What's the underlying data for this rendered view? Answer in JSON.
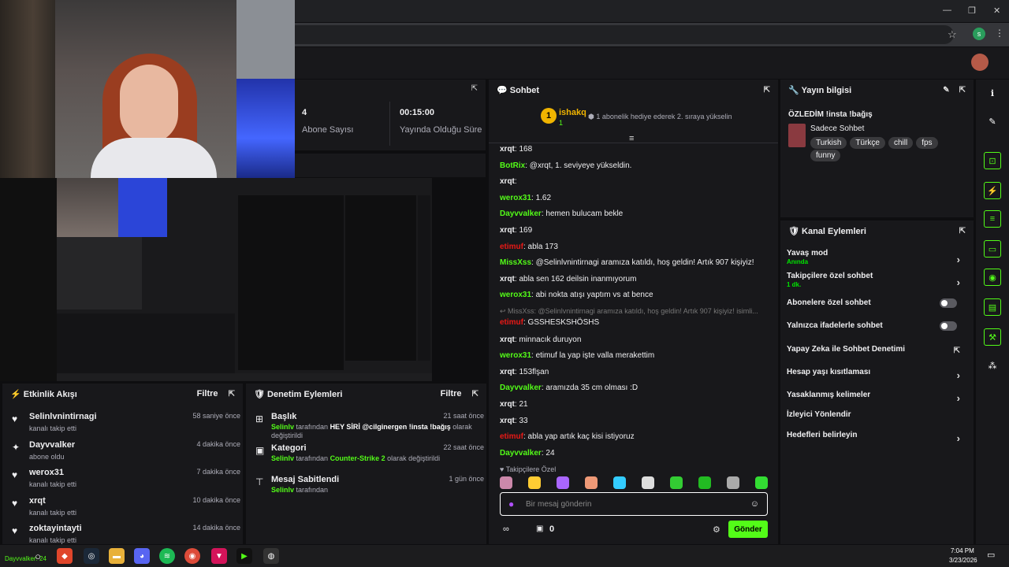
{
  "browser": {
    "window_controls": [
      "—",
      "❐",
      "✕"
    ],
    "profile_initial": "s"
  },
  "stats": [
    {
      "value": "4",
      "label": "Abone Sayısı"
    },
    {
      "value": "00:15:00",
      "label": "Yayında Olduğu Süre"
    }
  ],
  "chat": {
    "title": "Sohbet",
    "top_user": {
      "rank": "1",
      "name": "ishakq",
      "count": "1",
      "note": "1 abonelik hediye ederek 2. sıraya yükselin"
    },
    "messages": [
      {
        "user": "xrqt",
        "text": "168",
        "color": "#efeff1"
      },
      {
        "user": "BotRix",
        "text": "@xrqt, 1. seviyeye yükseldin.",
        "color": "#53fc18"
      },
      {
        "user": "xrqt",
        "text": "",
        "color": "#efeff1"
      },
      {
        "user": "werox31",
        "text": "1.62",
        "color": "#53fc18"
      },
      {
        "user": "Dayvvalker",
        "text": "hemen bulucam bekle",
        "color": "#53fc18"
      },
      {
        "user": "xrqt",
        "text": "169",
        "color": "#efeff1"
      },
      {
        "user": "etimuf",
        "text": "abla 173",
        "color": "#e91916"
      },
      {
        "user": "MissXss",
        "text": "@Selinlvnintirnagi aramıza katıldı, hoş geldin! Artık 907 kişiyiz!",
        "color": "#53fc18"
      },
      {
        "user": "xrqt",
        "text": "abla sen 162 deilsin inanmıyorum",
        "color": "#efeff1"
      },
      {
        "user": "werox31",
        "text": "abi nokta atışı yaptım vs at bence",
        "color": "#53fc18"
      },
      {
        "user": "etimuf",
        "text": "GSSHESKSHÖSHS",
        "color": "#e91916",
        "reply": "MissXss: @Selinlvnintirnagi aramıza katıldı, hoş geldin! Artık 907 kişiyiz!",
        "reply_tail": "isimli..."
      },
      {
        "user": "xrqt",
        "text": "minnacık duruyon",
        "color": "#efeff1"
      },
      {
        "user": "werox31",
        "text": "etimuf la yap işte valla merakettim",
        "color": "#53fc18"
      },
      {
        "user": "xrqt",
        "text": "153flşan",
        "color": "#efeff1"
      },
      {
        "user": "Dayvvalker",
        "text": "aramızda 35 cm olması :D",
        "color": "#53fc18"
      },
      {
        "user": "xrqt",
        "text": "21",
        "color": "#efeff1"
      },
      {
        "user": "xrqt",
        "text": "33",
        "color": "#efeff1"
      },
      {
        "user": "etimuf",
        "text": "abla yap artık kaç kisi istiyoruz",
        "color": "#e91916"
      },
      {
        "user": "Dayvvalker",
        "text": "24",
        "color": "#53fc18"
      }
    ],
    "emote_label": "Takipçilere Özel",
    "placeholder": "Bir mesaj gönderin",
    "points": "0",
    "send_label": "Gönder"
  },
  "stream_info": {
    "title": "Yayın bilgisi",
    "stream_title": "ÖZLEDİM !insta !bağış",
    "category": "Sadece Sohbet",
    "tags": [
      "Turkish",
      "Türkçe",
      "chill",
      "fps",
      "funny"
    ]
  },
  "channel_actions": {
    "title": "Kanal Eylemleri",
    "items": [
      {
        "label": "Yavaş mod",
        "sub": "Anında",
        "control": "chevron"
      },
      {
        "label": "Takipçilere özel sohbet",
        "sub": "1 dk.",
        "control": "chevron"
      },
      {
        "label": "Abonelere özel sohbet",
        "sub": "",
        "control": "toggle"
      },
      {
        "label": "Yalnızca ifadelerle sohbet",
        "sub": "",
        "control": "toggle"
      },
      {
        "label": "Yapay Zeka ile Sohbet Denetimi",
        "sub": "",
        "control": "external"
      },
      {
        "label": "Hesap yaşı kısıtlaması",
        "sub": "",
        "control": "chevron"
      },
      {
        "label": "Yasaklanmış kelimeler",
        "sub": "",
        "control": "chevron"
      },
      {
        "label": "İzleyici Yönlendir",
        "sub": "",
        "control": "none"
      },
      {
        "label": "Hedefleri belirleyin",
        "sub": "",
        "control": "chevron"
      }
    ]
  },
  "activity": {
    "title": "Etkinlik Akışı",
    "filter": "Filtre",
    "events": [
      {
        "name": "Selinlvnintirnagi",
        "action": "kanalı takip etti",
        "time": "58 saniye önce",
        "icon": "heart-icon",
        "glyph": "♥"
      },
      {
        "name": "Dayvvalker",
        "action": "abone oldu",
        "time": "4 dakika önce",
        "icon": "sparkle-icon",
        "glyph": "✦"
      },
      {
        "name": "werox31",
        "action": "kanalı takip etti",
        "time": "7 dakika önce",
        "icon": "heart-icon",
        "glyph": "♥"
      },
      {
        "name": "xrqt",
        "action": "kanalı takip etti",
        "time": "10 dakika önce",
        "icon": "heart-icon",
        "glyph": "♥"
      },
      {
        "name": "zoktayintayti",
        "action": "kanalı takip etti",
        "time": "14 dakika önce",
        "icon": "heart-icon",
        "glyph": "♥"
      }
    ]
  },
  "moderation": {
    "title": "Denetim Eylemleri",
    "filter": "Filtre",
    "items": [
      {
        "title": "Başlık",
        "by": "Selinlv",
        "mid": " tarafından ",
        "value": "HEY SİRİ @cilginergen !insta !bağış",
        "suffix": " olarak değiştirildi",
        "time": "21 saat önce"
      },
      {
        "title": "Kategori",
        "by": "Selinlv",
        "mid": " tarafından ",
        "value": "Counter-Strike 2",
        "suffix": " olarak değiştirildi",
        "time": "22 saat önce"
      },
      {
        "title": "Mesaj Sabitlendi",
        "by": "Selinlv",
        "mid": " tarafından",
        "value": "",
        "suffix": "",
        "time": "1 gün önce"
      }
    ]
  },
  "taskbar": {
    "user_label": "Dayvvalker: 24",
    "time": "7:04 PM",
    "date": "3/23/2026"
  }
}
